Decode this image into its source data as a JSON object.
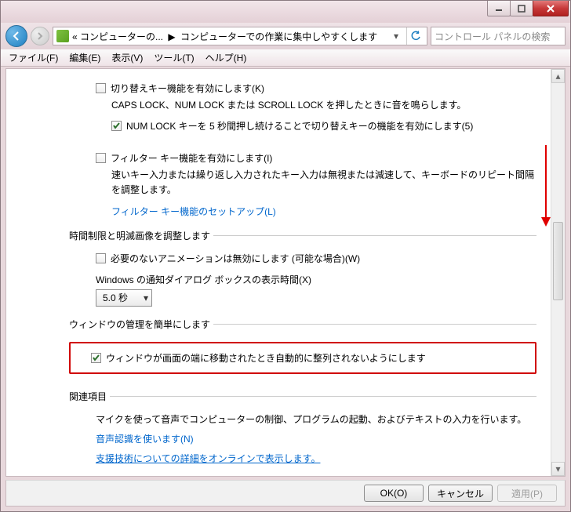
{
  "titlebar": {},
  "nav": {
    "crumb1": "« コンピューターの...",
    "crumb_sep": "▶",
    "crumb2": "コンピューターでの作業に集中しやすくします",
    "search_placeholder": "コントロール パネルの検索"
  },
  "menu": {
    "file": "ファイル(F)",
    "edit": "編集(E)",
    "view": "表示(V)",
    "tools": "ツール(T)",
    "help": "ヘルプ(H)"
  },
  "section_keys": {
    "toggle_label": "切り替えキー機能を有効にします(K)",
    "toggle_desc": "CAPS LOCK、NUM LOCK または SCROLL LOCK を押したときに音を鳴らします。",
    "numlock_label": "NUM LOCK キーを 5 秒間押し続けることで切り替えキーの機能を有効にします(5)",
    "filter_label": "フィルター キー機能を有効にします(I)",
    "filter_desc": "速いキー入力または繰り返し入力されたキー入力は無視または減速して、キーボードのリピート間隔を調整します。",
    "filter_link": "フィルター キー機能のセットアップ(L)"
  },
  "section_time": {
    "legend": "時間制限と明滅画像を調整します",
    "anim_label": "必要のないアニメーションは無効にします (可能な場合)(W)",
    "dialog_label": "Windows の通知ダイアログ ボックスの表示時間(X)",
    "dialog_value": "5.0 秒"
  },
  "section_window": {
    "legend": "ウィンドウの管理を簡単にします",
    "snap_label": "ウィンドウが画面の端に移動されたとき自動的に整列されないようにします"
  },
  "section_related": {
    "legend": "関連項目",
    "mic_text": "マイクを使って音声でコンピューターの制御、プログラムの起動、およびテキストの入力を行います。",
    "speech_link": "音声認識を使います(N)",
    "at_link": "支援技術についての詳細をオンラインで表示します。"
  },
  "footer": {
    "ok": "OK(O)",
    "cancel": "キャンセル",
    "apply": "適用(P)"
  }
}
